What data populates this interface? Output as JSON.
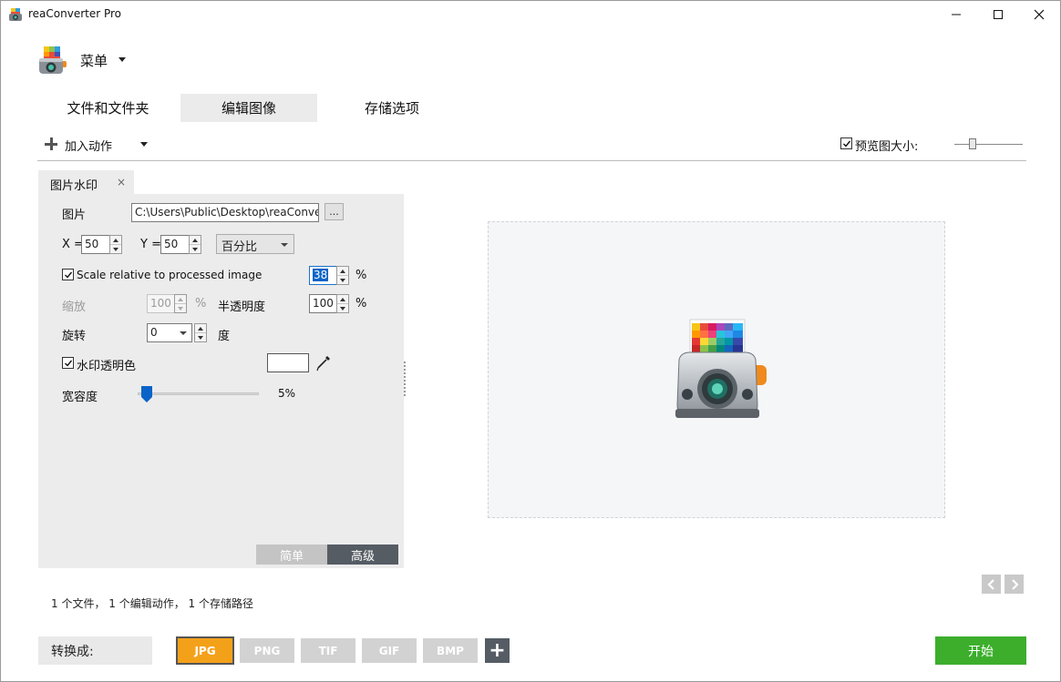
{
  "window": {
    "title": "reaConverter Pro",
    "minimize_icon": "minimize-icon",
    "maximize_icon": "maximize-icon",
    "close_icon": "close-icon"
  },
  "menu": {
    "label": "菜单"
  },
  "tabs": [
    {
      "label": "文件和文件夹",
      "active": false
    },
    {
      "label": "编辑图像",
      "active": true
    },
    {
      "label": "存储选项",
      "active": false
    }
  ],
  "actions": {
    "add_action_label": "加入动作",
    "preview_size_label": "预览图大小:",
    "preview_size_checked": true
  },
  "panel": {
    "tab_label": "图片水印",
    "close_glyph": "×",
    "image_label": "图片",
    "image_path": "C:\\Users\\Public\\Desktop\\reaConverte",
    "browse_label": "...",
    "x_label": "X =",
    "x_value": "50",
    "y_label": "Y =",
    "y_value": "50",
    "unit_select": "百分比",
    "scale_relative_label": "Scale relative to processed image",
    "scale_relative_checked": true,
    "scale_relative_value": "38",
    "percent_sign": "%",
    "zoom_label": "缩放",
    "zoom_value": "100",
    "opacity_label": "半透明度",
    "opacity_value": "100",
    "rotate_label": "旋转",
    "rotate_value": "0",
    "degree_label": "度",
    "transparent_color_label": "水印透明色",
    "transparent_color_checked": true,
    "transparent_color": "#ffffff",
    "tolerance_label": "宽容度",
    "tolerance_value_text": "5%",
    "tolerance_value": 5,
    "mode_simple": "简单",
    "mode_advanced": "高级"
  },
  "status": {
    "text": "1 个文件， 1 个编辑动作， 1 个存储路径"
  },
  "bottom": {
    "convert_label": "转换成:",
    "formats": [
      "JPG",
      "PNG",
      "TIF",
      "GIF",
      "BMP"
    ],
    "active_format": "JPG",
    "add_format": "+",
    "start_label": "开始"
  },
  "colors": {
    "accent_blue": "#0a64c8",
    "format_active": "#f4a11a",
    "start_green": "#3cae2c"
  }
}
